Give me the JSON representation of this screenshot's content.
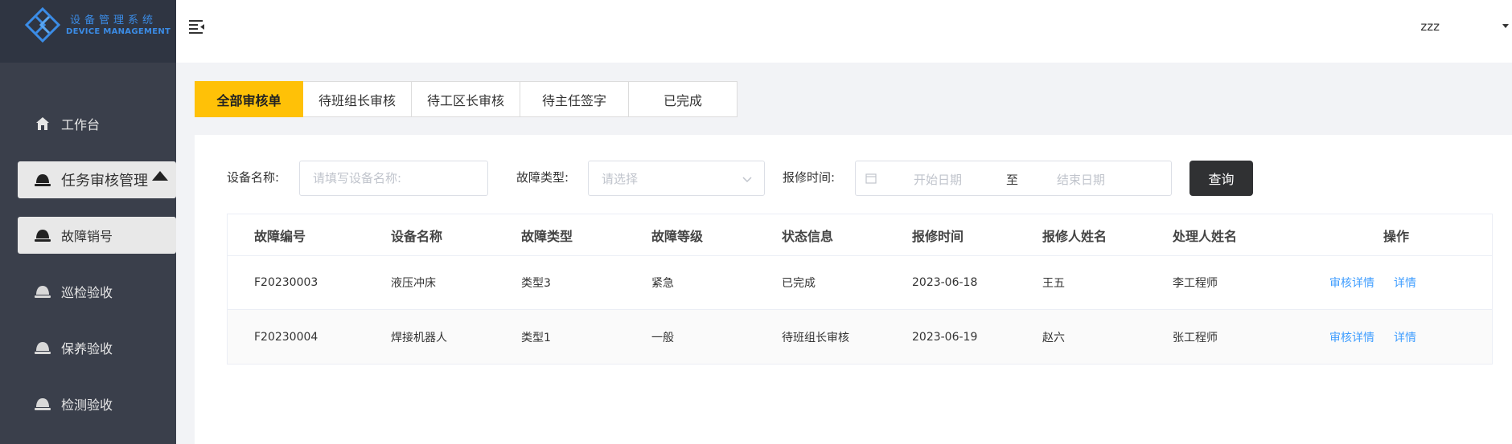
{
  "app": {
    "logo_cn": "设备管理系统",
    "logo_en": "DEVICE MANAGEMENT",
    "brand_color": "#3b8ce6"
  },
  "sidebar": {
    "items": [
      {
        "label": "工作台",
        "icon": "home-icon"
      },
      {
        "label": "任务审核管理",
        "icon": "bell-icon",
        "expanded": true
      },
      {
        "label": "故障销号",
        "icon": "bell-icon",
        "active": true
      },
      {
        "label": "巡检验收",
        "icon": "bell-icon"
      },
      {
        "label": "保养验收",
        "icon": "bell-icon"
      },
      {
        "label": "检测验收",
        "icon": "bell-icon"
      }
    ]
  },
  "header": {
    "user": "zzz"
  },
  "tabs": [
    {
      "label": "全部审核单",
      "active": true
    },
    {
      "label": "待班组长审核"
    },
    {
      "label": "待工区长审核"
    },
    {
      "label": "待主任签字"
    },
    {
      "label": "已完成"
    }
  ],
  "filters": {
    "device_name_label": "设备名称:",
    "device_name_placeholder": "请填写设备名称:",
    "fault_type_label": "故障类型:",
    "fault_type_placeholder": "请选择",
    "report_time_label": "报修时间:",
    "start_date_placeholder": "开始日期",
    "date_separator": "至",
    "end_date_placeholder": "结束日期",
    "query_button": "查询"
  },
  "table": {
    "columns": [
      "故障编号",
      "设备名称",
      "故障类型",
      "故障等级",
      "状态信息",
      "报修时间",
      "报修人姓名",
      "处理人姓名",
      "操作"
    ],
    "rows": [
      {
        "id": "F20230003",
        "device": "液压冲床",
        "type": "类型3",
        "level": "紧急",
        "status": "已完成",
        "time": "2023-06-18",
        "reporter": "王五",
        "handler": "李工程师"
      },
      {
        "id": "F20230004",
        "device": "焊接机器人",
        "type": "类型1",
        "level": "一般",
        "status": "待班组长审核",
        "time": "2023-06-19",
        "reporter": "赵六",
        "handler": "张工程师"
      }
    ],
    "actions": {
      "review_detail": "审核详情",
      "detail": "详情"
    }
  },
  "colors": {
    "tab_active": "#ffc107",
    "link": "#409eff",
    "sidebar_bg": "#3a3f4b",
    "button_dark": "#303133"
  }
}
